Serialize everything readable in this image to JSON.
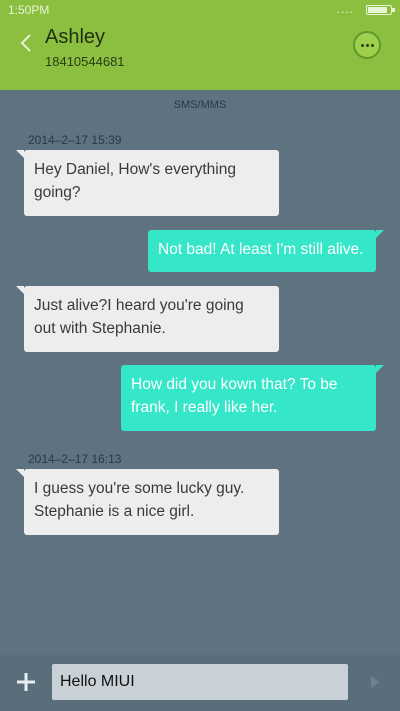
{
  "status_bar": {
    "time": "1:50PM",
    "signal": "....",
    "battery_level": 0.85
  },
  "header": {
    "contact_name": "Ashley",
    "contact_number": "18410544681"
  },
  "conversation": {
    "section_label": "SMS/MMS",
    "timestamps": [
      "2014–2–17 15:39",
      "2014–2–17 16:13"
    ],
    "messages": [
      {
        "direction": "in",
        "lines": [
          "Hey Daniel, How's everything",
          "going?"
        ]
      },
      {
        "direction": "out",
        "lines": [
          "Not bad! At least I'm still alive."
        ]
      },
      {
        "direction": "in",
        "lines": [
          "Just  alive?I heard you're going",
          "out with Stephanie."
        ]
      },
      {
        "direction": "out",
        "lines": [
          "How did you kown that? To be",
          "frank, I really like her."
        ]
      },
      {
        "direction": "in",
        "lines": [
          "I guess you're some lucky guy.",
          "Stephanie is a nice girl."
        ]
      }
    ]
  },
  "compose": {
    "input_value": "Hello MIUI"
  },
  "colors": {
    "accent": "#8cbf3f",
    "outgoing_bubble": "#35e6c8",
    "incoming_bubble": "#ededed",
    "background": "#5e7280"
  }
}
